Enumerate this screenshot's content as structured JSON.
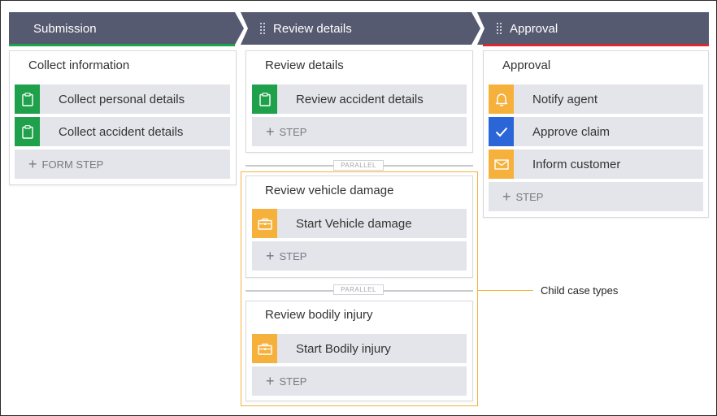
{
  "stages": [
    {
      "title": "Submission",
      "accent": "#1aa34a",
      "process": {
        "title": "Collect information",
        "steps": [
          {
            "label": "Collect personal details",
            "icon": "clipboard-icon",
            "color": "#1ea14a"
          },
          {
            "label": "Collect accident details",
            "icon": "clipboard-icon",
            "color": "#1ea14a"
          }
        ],
        "add_label": "FORM STEP"
      }
    },
    {
      "title": "Review details",
      "accent": "#565a70",
      "processes": [
        {
          "title": "Review details",
          "steps": [
            {
              "label": "Review accident details",
              "icon": "clipboard-icon",
              "color": "#1ea14a"
            }
          ],
          "add_label": "STEP"
        },
        {
          "title": "Review vehicle damage",
          "steps": [
            {
              "label": "Start Vehicle damage",
              "icon": "briefcase-icon",
              "color": "#f6b13d"
            }
          ],
          "add_label": "STEP"
        },
        {
          "title": "Review bodily injury",
          "steps": [
            {
              "label": "Start Bodily injury",
              "icon": "briefcase-icon",
              "color": "#f6b13d"
            }
          ],
          "add_label": "STEP"
        }
      ],
      "parallel_label": "PARALLEL"
    },
    {
      "title": "Approval",
      "accent": "#d9282f",
      "process": {
        "title": "Approval",
        "steps": [
          {
            "label": "Notify agent",
            "icon": "bell-icon",
            "color": "#f6b13d"
          },
          {
            "label": "Approve claim",
            "icon": "checkmark-icon",
            "color": "#2a66d8"
          },
          {
            "label": "Inform customer",
            "icon": "envelope-icon",
            "color": "#f6b13d"
          }
        ],
        "add_label": "STEP"
      }
    }
  ],
  "annotation": {
    "text": "Child case types",
    "color": "#f5b13c"
  },
  "colors": {
    "stage_header": "#565a70",
    "step_bg": "#e4e5ea"
  }
}
